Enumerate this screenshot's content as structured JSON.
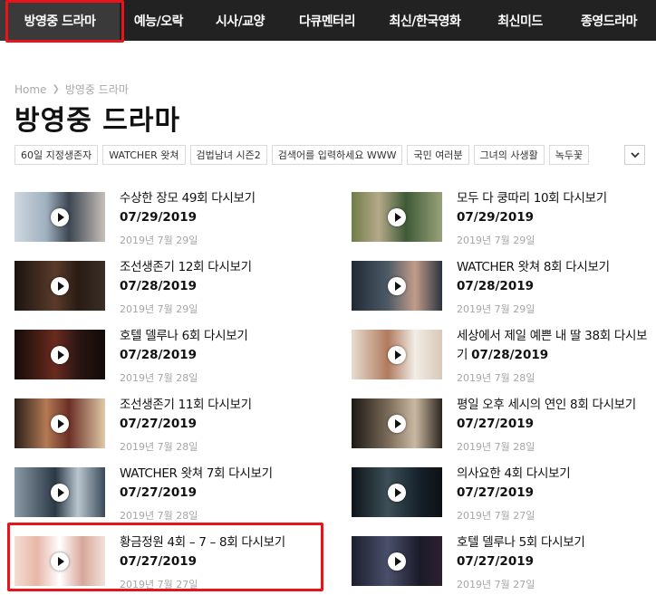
{
  "nav": {
    "items": [
      {
        "label": "방영중 드라마",
        "active": true
      },
      {
        "label": "예능/오락"
      },
      {
        "label": "시사/교양"
      },
      {
        "label": "다큐멘터리"
      },
      {
        "label": "최신/한국영화"
      },
      {
        "label": "최신미드"
      },
      {
        "label": "종영드라마"
      }
    ]
  },
  "breadcrumb": {
    "home": "Home",
    "current": "방영중 드라마"
  },
  "page_title": "방영중 드라마",
  "tags": [
    "60일 지정생존자",
    "WATCHER 왓쳐",
    "검법남녀 시즌2",
    "검색어를 입력하세요 WWW",
    "국민 여러분",
    "그녀의 사생활",
    "녹두꽃"
  ],
  "posts": [
    {
      "title": "수상한 장모 49회 다시보기",
      "air_date": "07/29/2019",
      "posted": "2019년 7월 29일"
    },
    {
      "title": "모두 다 쿵따리 10회 다시보기",
      "air_date": "07/29/2019",
      "posted": "2019년 7월 29일"
    },
    {
      "title": "조선생존기 12회 다시보기",
      "air_date": "07/28/2019",
      "posted": "2019년 7월 29일"
    },
    {
      "title": "WATCHER 왓쳐 8회 다시보기",
      "air_date": "07/28/2019",
      "posted": "2019년 7월 29일"
    },
    {
      "title": "호텔 델루나 6회 다시보기",
      "air_date": "07/28/2019",
      "posted": "2019년 7월 28일"
    },
    {
      "title": "세상에서 제일 예쁜 내 딸 38회 다시보기",
      "air_date": "07/28/2019",
      "posted": "2019년 7월 28일"
    },
    {
      "title": "조선생존기 11회 다시보기",
      "air_date": "07/27/2019",
      "posted": "2019년 7월 28일"
    },
    {
      "title": "평일 오후 세시의 연인 8회 다시보기",
      "air_date": "07/27/2019",
      "posted": "2019년 7월 28일"
    },
    {
      "title": "WATCHER 왓쳐 7회 다시보기",
      "air_date": "07/27/2019",
      "posted": "2019년 7월 28일"
    },
    {
      "title": "의사요한 4회 다시보기",
      "air_date": "07/27/2019",
      "posted": "2019년 7월 27일"
    },
    {
      "title": "황금정원 4회 – 7 – 8회 다시보기",
      "air_date": "07/27/2019",
      "posted": "2019년 7월 27일"
    },
    {
      "title": "호텔 델루나 5회 다시보기",
      "air_date": "07/27/2019",
      "posted": "2019년 7월 27일"
    }
  ],
  "colors": {
    "nav_bg": "#222222",
    "highlight": "#e8141a",
    "meta_text": "#a6a6a6"
  },
  "icons": [
    "chevron-right-icon",
    "chevron-down-icon",
    "play-icon"
  ]
}
